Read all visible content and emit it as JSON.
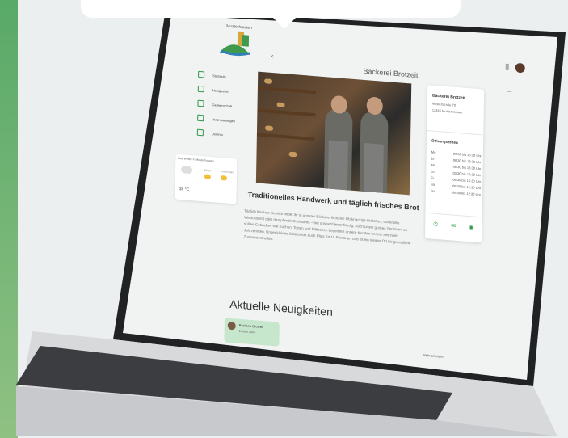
{
  "page": {
    "title": "Bäckerei Brotzeit"
  },
  "brand": {
    "logo_text": "Musterhausen"
  },
  "nav": [
    {
      "label": "Startseite"
    },
    {
      "label": "Neuigkeiten"
    },
    {
      "label": "Gemeinschaft"
    },
    {
      "label": "Veranstaltungen"
    },
    {
      "label": "Dorfinfo"
    }
  ],
  "weather": {
    "title": "Das Wetter in Musterhausen",
    "temp": "18 °C",
    "days": [
      "Morgen",
      "Übermorgen"
    ]
  },
  "business": {
    "name": "Bäckerei Brotzeit",
    "street": "Musterstraße 70",
    "city": "12345 Musterhausen",
    "hours_title": "Öffnungszeiten",
    "hours": [
      {
        "day": "Mo",
        "time": "06:30 bis 15:30 Uhr"
      },
      {
        "day": "Di",
        "time": "06:30 bis 12:30 Uhr"
      },
      {
        "day": "Mi",
        "time": "06:30 bis 16:30 Uhr"
      },
      {
        "day": "Do",
        "time": "03:30 bis 16:30 Uhr"
      },
      {
        "day": "Fr",
        "time": "06:30 bis 15:30 Uhr"
      },
      {
        "day": "Sa",
        "time": "06:30 bis 12:30 Uhr"
      },
      {
        "day": "So",
        "time": "06:30 bis 12:30 Uhr"
      }
    ]
  },
  "article": {
    "title": "Traditionelles Handwerk und täglich frisches Brot",
    "text": "Täglich frisches Gebäck findet ihr in unserer Bäckerei Brotzeit! Ob knackige Brötchen, duftendes Walnussbrot oder dampfende Croissants – bei uns wird jeder fündig. Auch unser großes Sortiment an süßen Gebäcken wie Kuchen, Torten und Plätzchen begeistert unsere Kunden bereits seit zwei Jahrzehnten. Unser kleines Café bietet auch Platz für 15 Personen und ist ein idealer Ort für gemütliche Zusammentreffen."
  },
  "news": {
    "title": "Aktuelle Neuigkeiten",
    "more": "Mehr anzeigen",
    "card": {
      "name": "Bäckerei Brotzeit",
      "date": "24.Juni 2024"
    }
  }
}
